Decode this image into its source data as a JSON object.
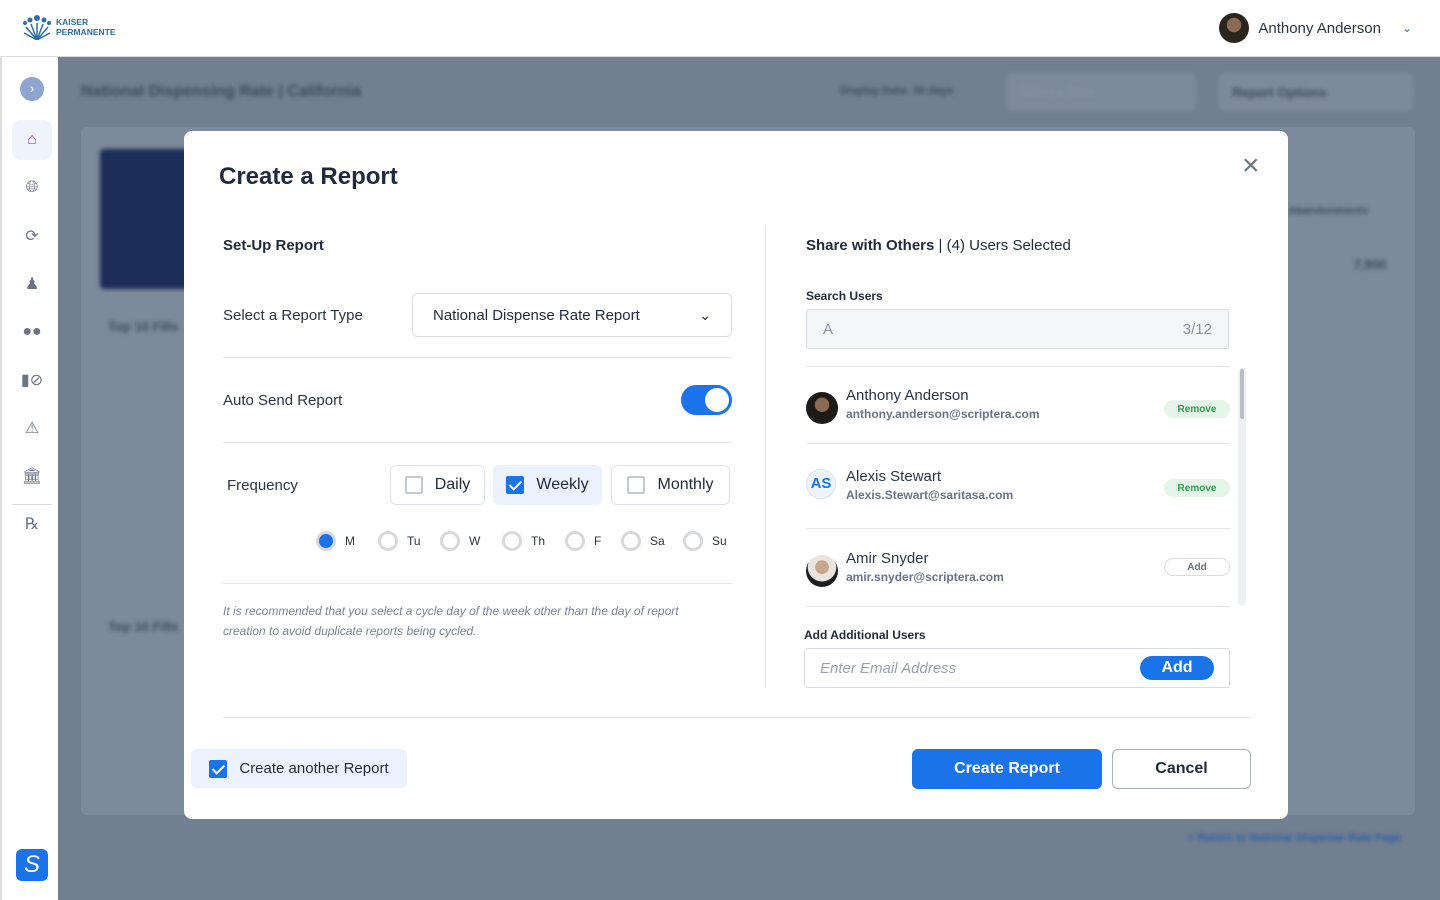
{
  "header": {
    "logo": "KAISER PERMANENTE",
    "user_name": "Anthony Anderson"
  },
  "sidebar": {
    "items": [
      "expand",
      "home",
      "globe",
      "refresh",
      "doctor",
      "pills",
      "no-pills",
      "alert",
      "institution",
      "rx",
      "scriptera"
    ]
  },
  "background": {
    "page_title": "National Dispensing Rate | California",
    "display_data": "Display Data: 30 days",
    "select_state": "Select a State",
    "report_options": "Report Options",
    "list_title": "Top 10 Fills",
    "list2_title": "Top 10 Fills",
    "column": "Abandonments",
    "value": "7,800",
    "return_link": "< Return to National Dispense Rate Page"
  },
  "modal": {
    "title": "Create a Report",
    "setup": {
      "heading": "Set-Up Report",
      "report_type_label": "Select a Report Type",
      "report_type_value": "National Dispense Rate Report",
      "auto_send_label": "Auto Send Report",
      "auto_send_on": true,
      "frequency_label": "Frequency",
      "frequencies": [
        {
          "label": "Daily",
          "checked": false
        },
        {
          "label": "Weekly",
          "checked": true
        },
        {
          "label": "Monthly",
          "checked": false
        }
      ],
      "days": [
        {
          "label": "M",
          "selected": true
        },
        {
          "label": "Tu"
        },
        {
          "label": "W"
        },
        {
          "label": "Th"
        },
        {
          "label": "F"
        },
        {
          "label": "Sa"
        },
        {
          "label": "Su"
        }
      ],
      "note": "It is recommended that you select a cycle day of the week other than the day of report creation to avoid duplicate reports being cycled."
    },
    "share": {
      "heading": "Share with Others",
      "selected": "(4) Users Selected",
      "search_label": "Search Users",
      "search_value": "A",
      "search_count": "3/12",
      "users": [
        {
          "name": "Anthony Anderson",
          "email": "anthony.anderson@scriptera.com",
          "action": "Remove"
        },
        {
          "name": "Alexis Stewart",
          "initials": "AS",
          "email": "Alexis.Stewart@saritasa.com",
          "action": "Remove"
        },
        {
          "name": "Amir Snyder",
          "email": "amir.snyder@scriptera.com",
          "action": "Add"
        }
      ],
      "add_label": "Add Additional Users",
      "email_placeholder": "Enter Email Address",
      "add_button": "Add"
    },
    "create_another": "Create another Report",
    "create_another_checked": true,
    "create_button": "Create Report",
    "cancel_button": "Cancel"
  },
  "colors": {
    "primary": "#1a73e8",
    "overlay": "#727f90",
    "remove_green": "#2e9e4f"
  }
}
